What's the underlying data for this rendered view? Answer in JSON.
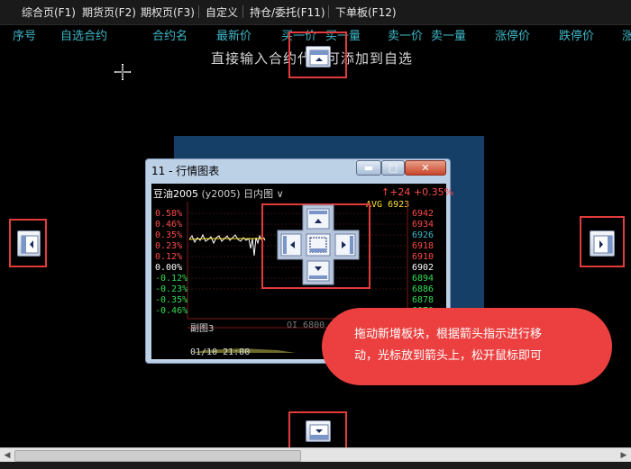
{
  "menubar": {
    "items": [
      "综合页(F1)",
      "期货页(F2)",
      "期权页(F3)",
      "自定义",
      "持仓/委托(F11)",
      "下单板(F12)"
    ]
  },
  "columns": {
    "headers": [
      "序号",
      "自选合约",
      "合约名",
      "最新价",
      "买一价",
      "买一量",
      "卖一价",
      "卖一量",
      "涨停价",
      "跌停价",
      "涨"
    ]
  },
  "hint_text": "直接输入合约代码可添加到自选",
  "window": {
    "title": "11 - 行情图表",
    "minimize_glyph": "▬",
    "maximize_glyph": "□",
    "close_glyph": "✕"
  },
  "chart": {
    "name": "豆油2005",
    "code": "(y2005)",
    "period": "日内图",
    "change": "↑+24 +0.35%",
    "avg_label": "AVG 6923",
    "left_axis": [
      "0.58%",
      "0.46%",
      "0.35%",
      "0.23%",
      "0.12%",
      "0.00%",
      "-0.12%",
      "-0.23%",
      "-0.35%",
      "-0.46%"
    ],
    "right_axis": [
      "6942",
      "6934",
      "6926",
      "6918",
      "6910",
      "6902",
      "6894",
      "6886",
      "6878",
      "6870"
    ],
    "sub_label": "副图3",
    "oi_label": "OI 6800",
    "time_label": "01/10 21:00",
    "colors": {
      "up": "#ff4a4a",
      "flat": "#ffffff",
      "down": "#33dd55",
      "highlight": "#3fb8c8"
    }
  },
  "tooltip": {
    "line1": "拖动新增板块，根据箭头指示进行移",
    "line2": "动，光标放到箭头上，松开鼠标即可"
  },
  "colors": {
    "accent_red": "#e23b3b",
    "column_text": "#3fb8c8"
  }
}
